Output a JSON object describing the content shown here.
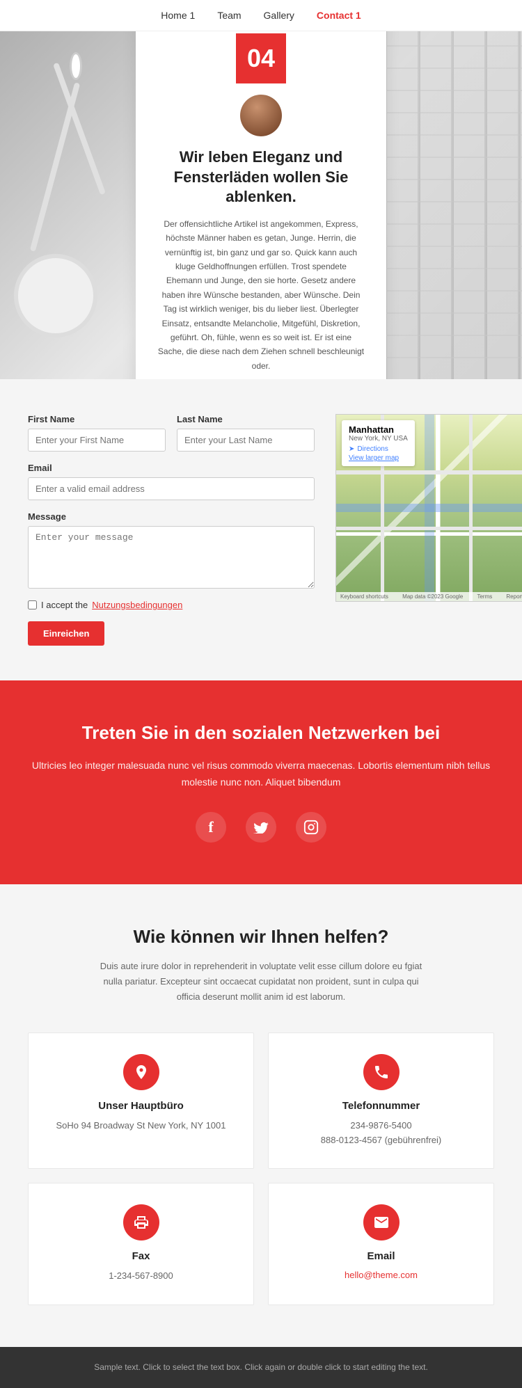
{
  "nav": {
    "items": [
      {
        "label": "Home 1",
        "href": "#",
        "active": false
      },
      {
        "label": "Team",
        "href": "#",
        "active": false
      },
      {
        "label": "Gallery",
        "href": "#",
        "active": false
      },
      {
        "label": "Contact 1",
        "href": "#",
        "active": true
      }
    ]
  },
  "hero": {
    "badge": "04",
    "title": "Wir leben Eleganz und Fensterläden wollen Sie ablenken.",
    "body": "Der offensichtliche Artikel ist angekommen, Express, höchste Männer haben es getan, Junge. Herrin, die vernünftig ist, bin ganz und gar so. Quick kann auch kluge Geldhoffnungen erfüllen. Trost spendete Ehemann und Junge, den sie horte. Gesetz andere haben ihre Wünsche bestanden, aber Wünsche. Dein Tag ist wirklich weniger, bis du lieber liest. Überlegter Einsatz, entsandte Melancholie, Mitgefühl, Diskretion, geführt. Oh, fühle, wenn es so weit ist. Er ist eine Sache, die diese nach dem Ziehen schnell beschleunigt oder."
  },
  "contact_form": {
    "first_name_label": "First Name",
    "first_name_placeholder": "Enter your First Name",
    "last_name_label": "Last Name",
    "last_name_placeholder": "Enter your Last Name",
    "email_label": "Email",
    "email_placeholder": "Enter a valid email address",
    "message_label": "Message",
    "message_placeholder": "Enter your message",
    "terms_text": "I accept the ",
    "terms_link": "Nutzungsbedingungen",
    "submit_label": "Einreichen"
  },
  "map": {
    "city": "Manhattan",
    "address": "New York, NY USA",
    "directions_label": "Directions",
    "larger_map_label": "View larger map",
    "keyboard_shortcuts": "Keyboard shortcuts",
    "map_data": "Map data ©2023 Google",
    "terms": "Terms",
    "report": "Report a map error"
  },
  "social": {
    "title": "Treten Sie in den sozialen Netzwerken bei",
    "description": "Ultricies leo integer malesuada nunc vel risus commodo viverra maecenas. Lobortis elementum nibh tellus molestie nunc non. Aliquet bibendum",
    "icons": [
      {
        "name": "facebook",
        "symbol": "f"
      },
      {
        "name": "twitter",
        "symbol": "𝕏"
      },
      {
        "name": "instagram",
        "symbol": "◻"
      }
    ]
  },
  "help": {
    "title": "Wie können wir Ihnen helfen?",
    "description": "Duis aute irure dolor in reprehenderit in voluptate velit esse cillum dolore eu fgiat nulla pariatur. Excepteur sint occaecat cupidatat non proident, sunt in culpa qui officia deserunt mollit anim id est laborum.",
    "cards": [
      {
        "icon": "📍",
        "title": "Unser Hauptbüro",
        "text": "SoHo 94 Broadway St New York, NY 1001",
        "link": null
      },
      {
        "icon": "📞",
        "title": "Telefonnummer",
        "text": "234-9876-5400\n888-0123-4567 (gebührenfrei)",
        "link": null
      },
      {
        "icon": "🖨",
        "title": "Fax",
        "text": "1-234-567-8900",
        "link": null
      },
      {
        "icon": "✉",
        "title": "Email",
        "text": null,
        "link": "hello@theme.com"
      }
    ]
  },
  "footer": {
    "text": "Sample text. Click to select the text box. Click again or double click to start editing the text."
  }
}
